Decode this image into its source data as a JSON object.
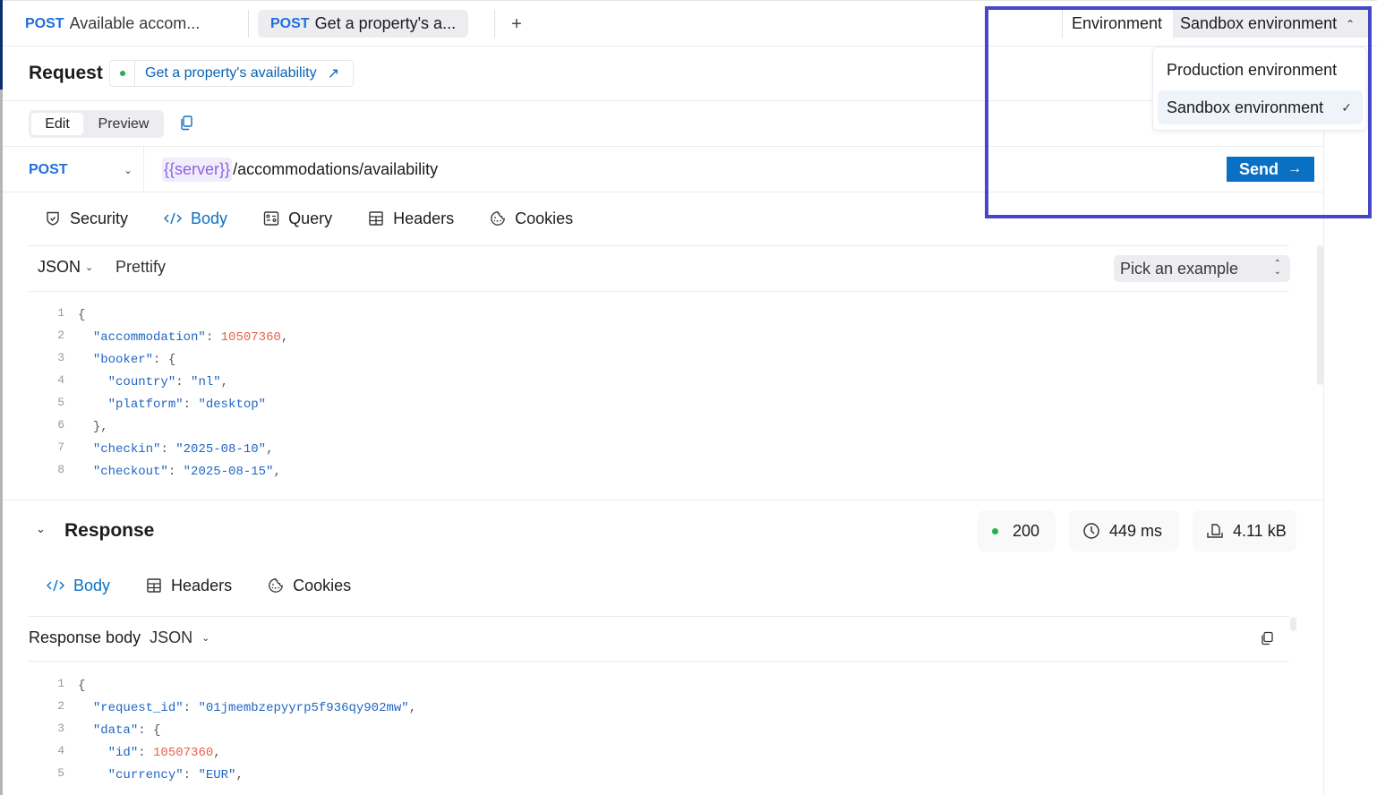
{
  "tabs": [
    {
      "method": "POST",
      "label": "Available accom...",
      "active": false
    },
    {
      "method": "POST",
      "label": "Get a property's a...",
      "active": true
    }
  ],
  "add_tab_label": "+",
  "environment": {
    "label": "Environment",
    "selected": "Sandbox environment",
    "menu_open": true,
    "options": [
      {
        "label": "Production environment",
        "selected": false
      },
      {
        "label": "Sandbox environment",
        "selected": true
      }
    ]
  },
  "request": {
    "title": "Request",
    "operation_link": "Get a property's availability",
    "modes": {
      "edit": "Edit",
      "preview": "Preview",
      "active": "Edit"
    },
    "method": "POST",
    "url_variable": "{{server}}",
    "url_path": "/accommodations/availability",
    "send_label": "Send",
    "tabs": [
      {
        "icon": "shield-check-icon",
        "label": "Security",
        "active": false
      },
      {
        "icon": "code-icon",
        "label": "Body",
        "active": true
      },
      {
        "icon": "query-icon",
        "label": "Query",
        "active": false
      },
      {
        "icon": "table-icon",
        "label": "Headers",
        "active": false
      },
      {
        "icon": "cookie-icon",
        "label": "Cookies",
        "active": false
      }
    ],
    "body_format": "JSON",
    "prettify_label": "Prettify",
    "example_placeholder": "Pick an example",
    "code_lines": [
      {
        "n": "1",
        "html": "<span class='p'>{</span>"
      },
      {
        "n": "2",
        "html": "  <span class='k'>\"accommodation\"</span><span class='p'>: </span><span class='n'>10507360</span><span class='p'>,</span>"
      },
      {
        "n": "3",
        "html": "  <span class='k'>\"booker\"</span><span class='p'>: {</span>"
      },
      {
        "n": "4",
        "html": "    <span class='k'>\"country\"</span><span class='p'>: </span><span class='s'>\"nl\"</span><span class='p'>,</span>"
      },
      {
        "n": "5",
        "html": "    <span class='k'>\"platform\"</span><span class='p'>: </span><span class='s'>\"desktop\"</span>"
      },
      {
        "n": "6",
        "html": "  <span class='p'>},</span>"
      },
      {
        "n": "7",
        "html": "  <span class='k'>\"checkin\"</span><span class='p'>: </span><span class='s'>\"2025-08-10\"</span><span class='p'>,</span>"
      },
      {
        "n": "8",
        "html": "  <span class='k'>\"checkout\"</span><span class='p'>: </span><span class='s'>\"2025-08-15\"</span><span class='p'>,</span>"
      }
    ]
  },
  "response": {
    "title": "Response",
    "status_code": "200",
    "status_color": "#22b24c",
    "time": "449 ms",
    "size": "4.11 kB",
    "tabs": [
      {
        "icon": "code-icon",
        "label": "Body",
        "active": true
      },
      {
        "icon": "table-icon",
        "label": "Headers",
        "active": false
      },
      {
        "icon": "cookie-icon",
        "label": "Cookies",
        "active": false
      }
    ],
    "body_label": "Response body",
    "body_format": "JSON",
    "code_lines": [
      {
        "n": "1",
        "html": "<span class='p'>{</span>"
      },
      {
        "n": "2",
        "html": "  <span class='k'>\"request_id\"</span><span class='p'>: </span><span class='s'>\"01jmembzepyyrp5f936qy902mw\"</span><span class='p'>,</span>"
      },
      {
        "n": "3",
        "html": "  <span class='k'>\"data\"</span><span class='p'>: {</span>"
      },
      {
        "n": "4",
        "html": "    <span class='k'>\"id\"</span><span class='p'>: </span><span class='n'>10507360</span><span class='p'>,</span>"
      },
      {
        "n": "5",
        "html": "    <span class='k'>\"currency\"</span><span class='p'>: </span><span class='s'>\"EUR\"</span><span class='p'>,</span>"
      }
    ]
  },
  "colors": {
    "accent": "#0a70c4",
    "method": "#1f6fe0",
    "variable": "#8a63e0",
    "number": "#e8604c",
    "highlight_box": "#4648c8"
  }
}
